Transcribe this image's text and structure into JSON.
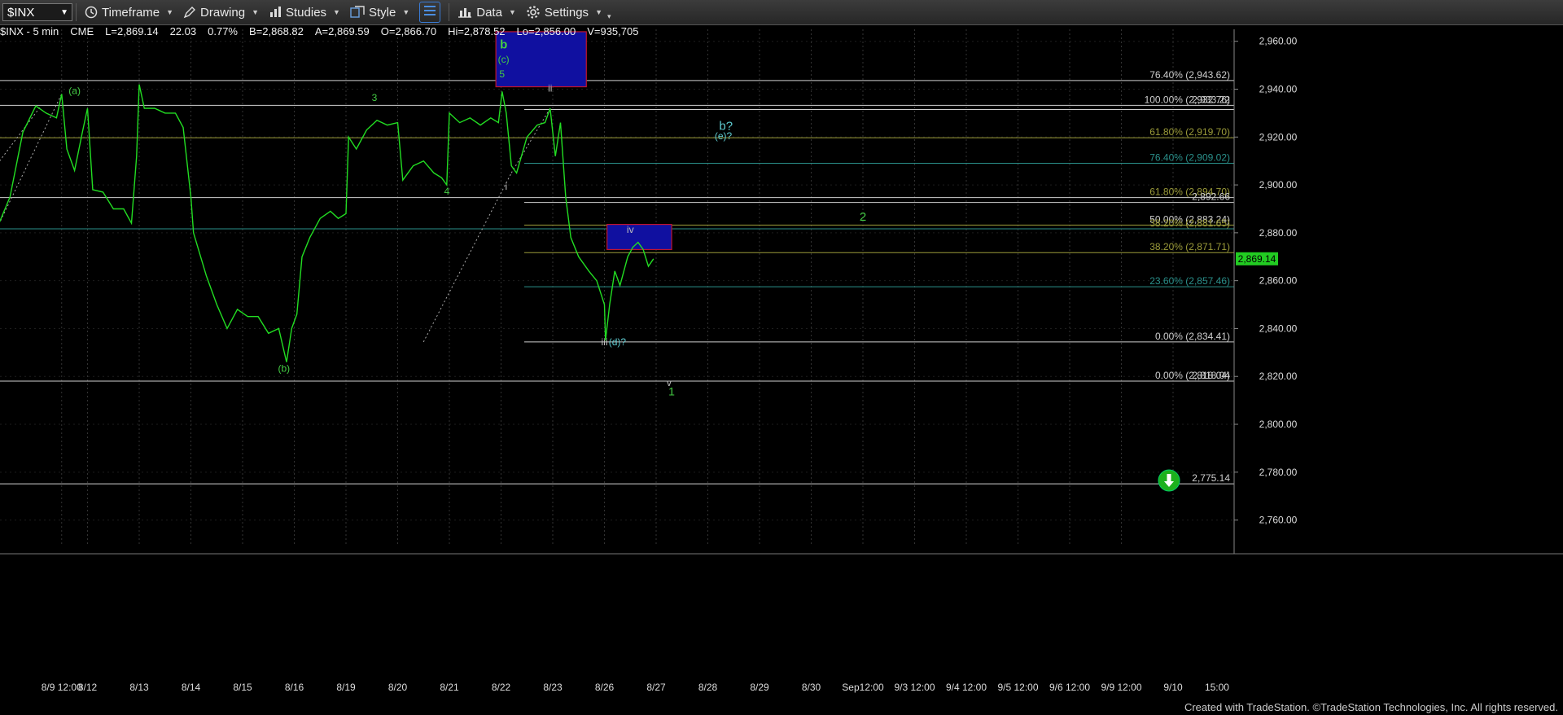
{
  "toolbar": {
    "symbol": "$INX",
    "timeframe_label": "Timeframe",
    "drawing_label": "Drawing",
    "studies_label": "Studies",
    "style_label": "Style",
    "data_label": "Data",
    "settings_label": "Settings"
  },
  "quote": {
    "title": "$INX - 5 min",
    "exchange": "CME",
    "last": "L=2,869.14",
    "change": "22.03",
    "change_pct": "0.77%",
    "bid": "B=2,868.82",
    "ask": "A=2,869.59",
    "open": "O=2,866.70",
    "high": "Hi=2,878.52",
    "low": "Lo=2,856.00",
    "volume": "V=935,705"
  },
  "footer": "Created with TradeStation. ©TradeStation Technologies, Inc. All rights reserved.",
  "colors": {
    "price": "#22dd22",
    "wave_green": "#44cc44",
    "wave_cyan": "#5ecbd0",
    "wave_gray": "#bfbfbf",
    "fib_teal": "#2a8f8a",
    "fib_olive": "#9c9c3a",
    "box_blue": "#1010a0",
    "box_red": "#c0142e",
    "last_price_bg": "#22cc22"
  },
  "chart_data": {
    "type": "line",
    "title": "$INX - 5 min",
    "ylim": [
      2750,
      2965
    ],
    "y_ticks": [
      "2,960.00",
      "2,940.00",
      "2,920.00",
      "2,900.00",
      "2,880.00",
      "2,860.00",
      "2,840.00",
      "2,820.00",
      "2,800.00",
      "2,780.00",
      "2,760.00"
    ],
    "y_tick_values": [
      2960,
      2940,
      2920,
      2900,
      2880,
      2860,
      2840,
      2820,
      2800,
      2780,
      2760
    ],
    "x_labels": [
      "8/9 12:00",
      "8/12",
      "8/13",
      "8/14",
      "8/15",
      "8/16",
      "8/19",
      "8/20",
      "8/21",
      "8/22",
      "8/23",
      "8/26",
      "8/27",
      "8/28",
      "8/29",
      "8/30",
      "Sep12:00",
      "9/3 12:00",
      "9/4 12:00",
      "9/5 12:00",
      "9/6 12:00",
      "9/9 12:00",
      "9/10",
      "15:00"
    ],
    "x_label_index": [
      0.5,
      1,
      2,
      3,
      4,
      5,
      6,
      7,
      8,
      9,
      10,
      11,
      12,
      13,
      14,
      15,
      16,
      17,
      18,
      19,
      20,
      21,
      22,
      22.85
    ],
    "last_price": {
      "value": 2869.14,
      "label": "2,869.14"
    },
    "series": [
      {
        "values": [
          [
            -0.75,
            2882
          ],
          [
            -0.5,
            2895
          ],
          [
            -0.25,
            2922
          ],
          [
            0,
            2933
          ],
          [
            0.2,
            2930
          ],
          [
            0.4,
            2928
          ],
          [
            0.5,
            2938
          ],
          [
            0.6,
            2915
          ],
          [
            0.75,
            2906
          ],
          [
            0.9,
            2922
          ],
          [
            1,
            2932
          ],
          [
            1.1,
            2898
          ],
          [
            1.3,
            2897
          ],
          [
            1.5,
            2890
          ],
          [
            1.7,
            2890
          ],
          [
            1.85,
            2884
          ],
          [
            1.95,
            2912
          ],
          [
            2,
            2942
          ],
          [
            2.1,
            2932
          ],
          [
            2.3,
            2932
          ],
          [
            2.5,
            2930
          ],
          [
            2.7,
            2930
          ],
          [
            2.85,
            2924
          ],
          [
            3,
            2895
          ],
          [
            3.05,
            2880
          ],
          [
            3.3,
            2862
          ],
          [
            3.5,
            2850
          ],
          [
            3.7,
            2840
          ],
          [
            3.9,
            2848
          ],
          [
            4.1,
            2845
          ],
          [
            4.3,
            2845
          ],
          [
            4.5,
            2838
          ],
          [
            4.7,
            2840
          ],
          [
            4.85,
            2826
          ],
          [
            4.95,
            2840
          ],
          [
            5.05,
            2846
          ],
          [
            5.15,
            2870
          ],
          [
            5.3,
            2878
          ],
          [
            5.5,
            2886
          ],
          [
            5.7,
            2889
          ],
          [
            5.85,
            2886
          ],
          [
            6,
            2888
          ],
          [
            6.05,
            2920
          ],
          [
            6.2,
            2915
          ],
          [
            6.4,
            2923
          ],
          [
            6.6,
            2927
          ],
          [
            6.8,
            2925
          ],
          [
            7,
            2926
          ],
          [
            7.1,
            2902
          ],
          [
            7.3,
            2908
          ],
          [
            7.5,
            2910
          ],
          [
            7.7,
            2905
          ],
          [
            7.85,
            2903
          ],
          [
            7.95,
            2900
          ],
          [
            8,
            2930
          ],
          [
            8.2,
            2926
          ],
          [
            8.4,
            2928
          ],
          [
            8.6,
            2925
          ],
          [
            8.8,
            2928
          ],
          [
            8.95,
            2926
          ],
          [
            9.02,
            2939
          ],
          [
            9.1,
            2930
          ],
          [
            9.2,
            2908
          ],
          [
            9.3,
            2905
          ],
          [
            9.5,
            2920
          ],
          [
            9.7,
            2925
          ],
          [
            9.85,
            2926
          ],
          [
            9.95,
            2932
          ],
          [
            10.05,
            2912
          ],
          [
            10.15,
            2926
          ],
          [
            10.25,
            2895
          ],
          [
            10.35,
            2878
          ],
          [
            10.5,
            2870
          ],
          [
            10.7,
            2864
          ],
          [
            10.85,
            2860
          ],
          [
            11,
            2850
          ],
          [
            11.02,
            2835
          ],
          [
            11.1,
            2850
          ],
          [
            11.2,
            2864
          ],
          [
            11.3,
            2858
          ],
          [
            11.45,
            2870
          ],
          [
            11.55,
            2874
          ],
          [
            11.65,
            2876
          ],
          [
            11.75,
            2873
          ],
          [
            11.85,
            2866
          ],
          [
            11.95,
            2869.14
          ]
        ]
      }
    ],
    "fib_levels": [
      {
        "value": 2943.62,
        "label": "76.40% (2,943.62)"
      },
      {
        "value": 2933.22,
        "label": "100.00% (2,932.76)"
      },
      {
        "value": 2919.7,
        "label": "61.80% (2,919.70)"
      },
      {
        "value": 2909.02,
        "label": "76.40% (2,909.02)"
      },
      {
        "value": 2894.7,
        "label": "61.80% (2,894.70)"
      },
      {
        "value": 2883.24,
        "label": "50.00% (2,883.24)"
      },
      {
        "value": 2881.65,
        "label": "38.20% (2,881.65)"
      },
      {
        "value": 2871.71,
        "label": "38.20% (2,871.71)"
      },
      {
        "value": 2857.46,
        "label": "23.60% (2,857.46)"
      },
      {
        "value": 2834.41,
        "label": "0.00% (2,834.41)"
      },
      {
        "value": 2818.04,
        "label": "0.00% (2,818.04)"
      }
    ],
    "price_labels": [
      {
        "value": 2933.22,
        "label": "2,933.22"
      },
      {
        "value": 2892.66,
        "label": "2,892.66"
      },
      {
        "value": 2818.04,
        "label": "2,818.04"
      },
      {
        "value": 2775.14,
        "label": "2,775.14"
      }
    ],
    "wave_labels": [
      {
        "text": "(a)",
        "x": 0.75,
        "y": 2938
      },
      {
        "text": "(b)",
        "x": 4.8,
        "y": 2822
      },
      {
        "text": "3",
        "x": 6.55,
        "y": 2935
      },
      {
        "text": "4",
        "x": 7.95,
        "y": 2896
      },
      {
        "text": "b",
        "x": 9.05,
        "y": 2957
      },
      {
        "text": "(c)",
        "x": 9.05,
        "y": 2951
      },
      {
        "text": "5",
        "x": 9.02,
        "y": 2945
      },
      {
        "text": "ii",
        "x": 9.95,
        "y": 2939
      },
      {
        "text": "i",
        "x": 9.1,
        "y": 2898
      },
      {
        "text": "iv",
        "x": 11.5,
        "y": 2880
      },
      {
        "text": "iii",
        "x": 11.0,
        "y": 2833
      },
      {
        "text": "(d)?",
        "x": 11.25,
        "y": 2833
      },
      {
        "text": "b?",
        "x": 13.35,
        "y": 2923
      },
      {
        "text": "(e)?",
        "x": 13.3,
        "y": 2919
      },
      {
        "text": "2",
        "x": 16.0,
        "y": 2885
      },
      {
        "text": "v",
        "x": 12.25,
        "y": 2816
      },
      {
        "text": "1",
        "x": 12.3,
        "y": 2812
      }
    ]
  }
}
